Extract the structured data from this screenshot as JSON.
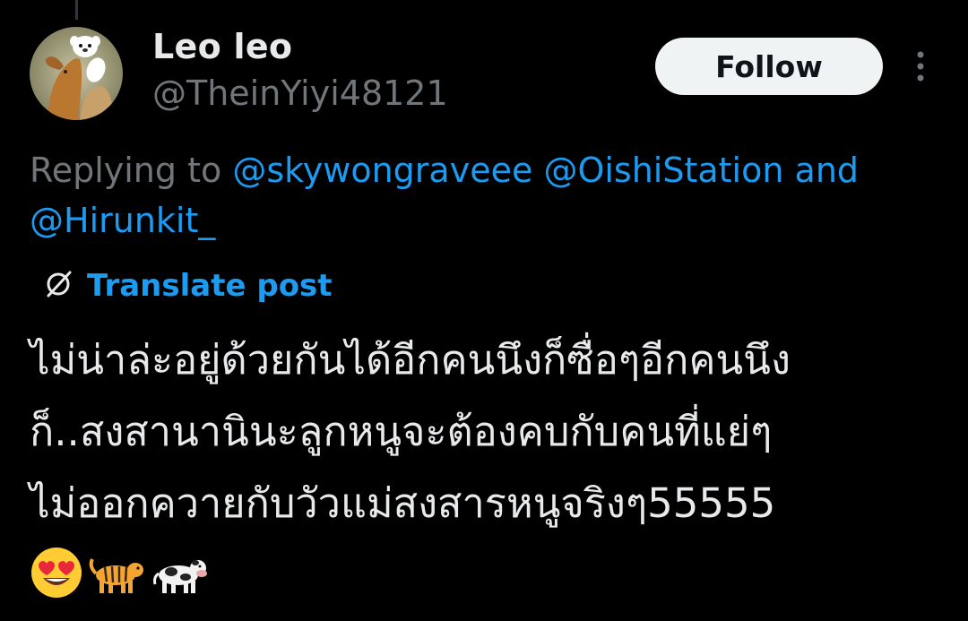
{
  "author": {
    "display_name": "Leo leo",
    "handle": "@TheinYiyi48121",
    "avatar_icon": "avatar-dog-llama-icon"
  },
  "actions": {
    "follow_label": "Follow",
    "more_icon": "more-vertical-icon"
  },
  "reply_context": {
    "prefix": "Replying to",
    "mentions": [
      "@skywongraveee",
      "@OishiStation",
      "@Hirunkit_"
    ],
    "conjunction": "and"
  },
  "translate": {
    "label": "Translate post",
    "icon": "translate-icon"
  },
  "post": {
    "lines": [
      "ไม่น่าล่ะอยู่ด้วยกันได้อีกคนนึงก็ซื่อๆอีกคนนึง",
      "ก็..สงสานานินะลูกหนูจะต้องคบกับคนที่แย่ๆ",
      "ไม่ออกควายกับวัวแม่สงสารหนูจริงๆ55555"
    ],
    "emojis": [
      "😍",
      "🐅",
      "🐄"
    ],
    "emoji_icons": [
      "heart-eyes-emoji-icon",
      "tiger-emoji-icon",
      "cow-emoji-icon"
    ]
  },
  "colors": {
    "background": "#000000",
    "text": "#e7e9ea",
    "secondary": "#71767b",
    "accent": "#1d9bf0",
    "button_bg": "#eff3f4"
  }
}
